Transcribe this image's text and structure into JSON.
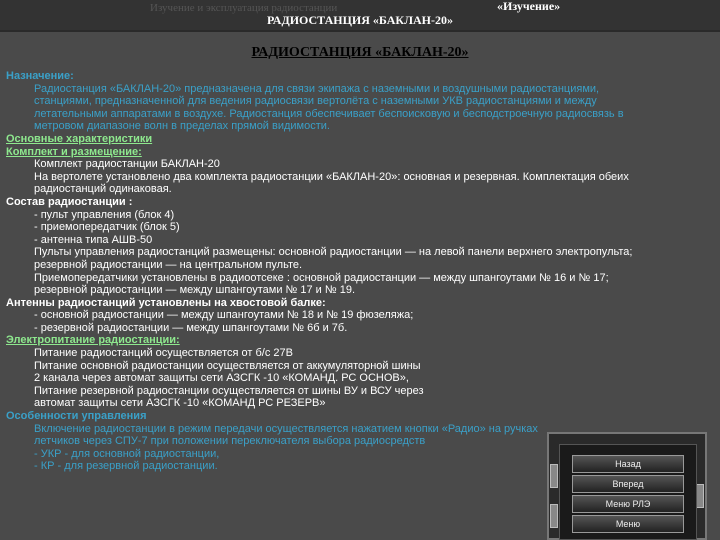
{
  "header": {
    "faint_text": "Изучение и эксплуатация радиостанции",
    "badge": "«Изучение»",
    "title": "РАДИОСТАНЦИЯ «БАКЛАН-20»"
  },
  "page_title": "РАДИОСТАНЦИЯ «БАКЛАН-20»",
  "sections": {
    "purpose": {
      "heading": "Назначение:",
      "lines": [
        "Радиостанция «БАКЛАН-20» предназначена для связи экипажа с наземными и воздушными радиостанциями,",
        "станциями, предназначенной для ведения радиосвязи вертолёта с наземными УКВ радиостанциями и между",
        "летательными аппаратами в воздухе. Радиостанция обеспечивает беспоисковую и бесподстроечную радиосвязь в",
        "метровом диапазоне волн в пределах прямой видимости."
      ]
    },
    "characteristics": {
      "heading": "Основные характеристики"
    },
    "kit": {
      "heading": "Комплект и размещение:",
      "lines": [
        "Комплект радиостанции БАКЛАН-20",
        " На вертолете установлено два комплекта радиостанции «БАКЛАН-20»: основная и резервная. Комплектация обеих",
        "радиостанций одинаковая."
      ]
    },
    "composition": {
      "heading": "Состав радиостанции :",
      "lines": [
        "- пульт управления (блок 4)",
        "- приемопередатчик (блок 5)",
        "- антенна типа АШВ-50",
        "Пульты управления радиостанций размещены: основной радиостанции — на левой панели верхнего электропульта;",
        "резервной радиостанции — на центральном пульте.",
        "Приемопередатчики установлены в радиоотсеке : основной радиостанции — между шпангоутами № 16 и № 17;",
        "резервной радиостанции — между шпангоутами № 17 и № 19."
      ]
    },
    "antennas": {
      "heading": "Антенны радиостанций установлены на хвостовой балке:",
      "lines": [
        "- основной радиостанции — между шпангоутами № 18 и № 19 фюзеляжа;",
        "- резервной радиостанции — между шпангоутами № 6б и 7б."
      ]
    },
    "power": {
      "heading": "Электропитание радиостанции:",
      "lines": [
        "Питание радиостанций осуществляется от б/с 27В",
        "Питание основной радиостанции осуществляется от аккумуляторной шины",
        "2 канала через автомат защиты сети  АЗСГК -10  «КОМАНД. РС ОСНОВ»,",
        "Питание резервной радиостанции осуществляется от шины ВУ и ВСУ через",
        "автомат защиты сети  АЗСГК -10  «КОМАНД РС РЕЗЕРВ»"
      ]
    },
    "control": {
      "heading": "Особенности управления",
      "lines": [
        "Включение радиостанции в режим передачи осуществляется нажатием кнопки «Радио» на ручках",
        "летчиков через СПУ-7 при положении переключателя выбора радиосредств",
        "- УКР - для основной радиостанции,",
        "- КР  - для резервной радиостанции."
      ]
    }
  },
  "menu": {
    "buttons": [
      "Назад",
      "Вперед",
      "Меню РЛЭ",
      "Меню"
    ]
  }
}
